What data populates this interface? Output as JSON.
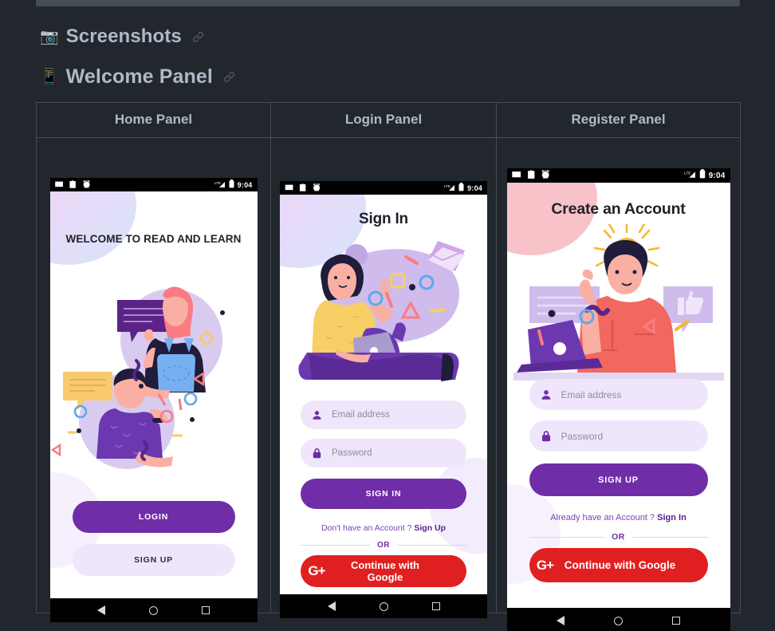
{
  "document": {
    "background_color": "#22272e",
    "border_color": "#444c56",
    "heading_color": "#adbac7"
  },
  "headings": [
    {
      "emoji": "📷",
      "emoji_name": "camera-emoji",
      "text": "Screenshots",
      "anchor": "link-icon"
    },
    {
      "emoji": "📱",
      "emoji_name": "mobile-phone-emoji",
      "text": "Welcome Panel",
      "anchor": "link-icon"
    }
  ],
  "table": {
    "columns": [
      "Home Panel",
      "Login Panel",
      "Register Panel"
    ]
  },
  "status_bar": {
    "icons": [
      "mail-icon",
      "clipboard-icon",
      "alarm-icon"
    ],
    "signal": "LTE",
    "battery": "battery-icon",
    "time": "9:04"
  },
  "nav_bar": {
    "back": "back-triangle-icon",
    "home": "home-circle-icon",
    "recents": "recents-square-icon"
  },
  "screens": {
    "home": {
      "title": "WELCOME TO READ AND LEARN",
      "illustration": "two-people-with-speech-bubbles-illustration",
      "login_button": "LOGIN",
      "signup_button": "SIGN UP",
      "colors": {
        "primary": "#6f2da8",
        "secondary": "#f0e6fb"
      }
    },
    "login": {
      "title": "Sign In",
      "illustration": "woman-with-laptop-illustration",
      "email_placeholder": "Email address",
      "password_placeholder": "Password",
      "submit_button": "SIGN IN",
      "switch_prompt": "Don't have an Account ?",
      "switch_link": "Sign Up",
      "divider": "OR",
      "google_button": "Continue with Google",
      "google_icon": "google-plus-icon",
      "colors": {
        "primary": "#6f2da8",
        "google": "#e02020"
      }
    },
    "register": {
      "title": "Create an Account",
      "illustration": "man-with-lightbulb-and-laptop-illustration",
      "email_placeholder": "Email address",
      "password_placeholder": "Password",
      "submit_button": "SIGN UP",
      "switch_prompt": "Already have an Account ?",
      "switch_link": "Sign In",
      "divider": "OR",
      "google_button": "Continue with Google",
      "google_icon": "google-plus-icon",
      "colors": {
        "primary": "#6f2da8",
        "google": "#e02020",
        "accent": "#f8c2c9"
      }
    }
  }
}
